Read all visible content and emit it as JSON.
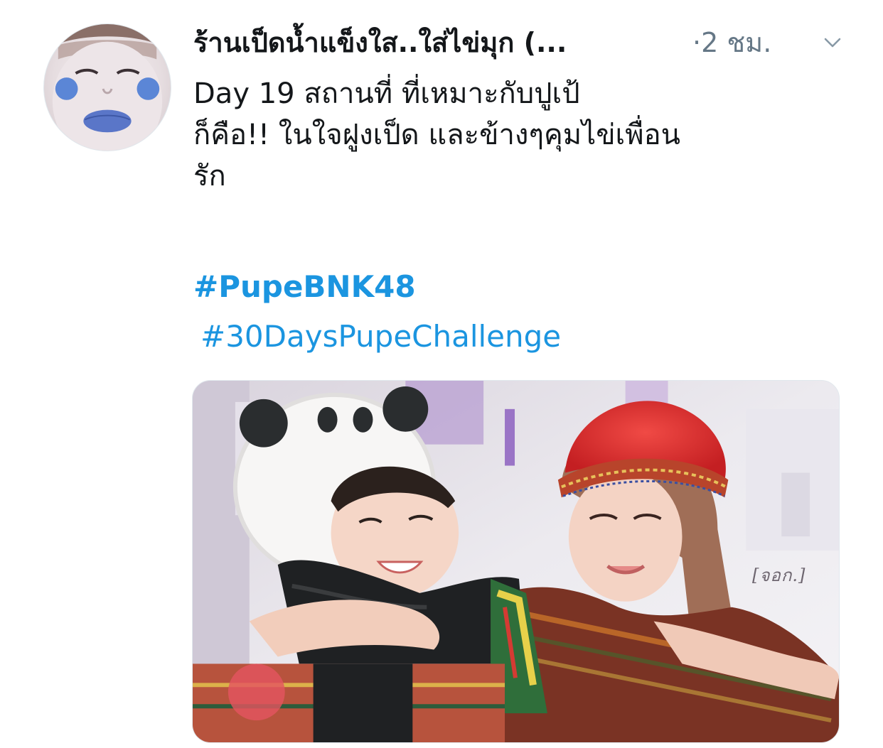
{
  "tweet": {
    "author": {
      "display_name": "ร้านเป็ดน้ำแข็งใส..ใส่ไข่มุก (...",
      "avatar_icon": "avatar-image"
    },
    "meta": {
      "separator": "·",
      "timestamp": "2 ชม."
    },
    "more_icon": "chevron-down-icon",
    "text_lines": [
      "Day 19 สถานที่ ที่เหมาะกับปูเป้",
      "ก็คือ!! ในใจฝูงเป็ด และข้างๆคุมไข่เพื่อน",
      "รัก"
    ],
    "hashtags": [
      "#PupeBNK48",
      " #30DaysPupeChallenge"
    ],
    "media": {
      "watermark": "[จอก.]"
    },
    "colors": {
      "text": "#14171a",
      "secondary": "#657786",
      "link": "#1b95e0",
      "border": "#e1e8ed"
    }
  }
}
